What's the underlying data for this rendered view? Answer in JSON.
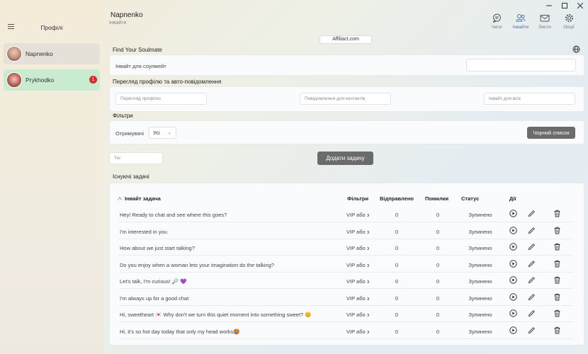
{
  "sidebar": {
    "title": "Профілі",
    "profiles": [
      {
        "name": "Napnenko",
        "badge": ""
      },
      {
        "name": "Prykhodko",
        "badge": "1"
      }
    ]
  },
  "header": {
    "title": "Napnenko",
    "subtitle": "Інвайти",
    "tabs": [
      {
        "label": "Чати",
        "icon": "chat-icon"
      },
      {
        "label": "Інвайти",
        "icon": "users-icon"
      },
      {
        "label": "Листи",
        "icon": "mail-icon"
      },
      {
        "label": "Опції",
        "icon": "gear-icon"
      }
    ],
    "active_tab": "Інвайти"
  },
  "affiliate_label": "Affiliact.com",
  "soulmate": {
    "section_title": "Find Your Soulmate",
    "invite_label": "Інвайт для соулмейт",
    "invite_value": ""
  },
  "profile_view": {
    "section_title": "Перегляд профілю та авто-повідомлення",
    "view_placeholder": "Перегляд профілю",
    "contacts_placeholder": "Повідомлення для контактів",
    "all_placeholder": "Інвайт для всіх"
  },
  "filters": {
    "section_title": "Фільтри",
    "recipients_label": "Отримувачі",
    "recipients_value": "Усі",
    "blacklist_button": "Чорний список"
  },
  "tag_placeholder": "Тег",
  "add_task_button": "Додати задачу",
  "tasks": {
    "section_title": "Існуючі задачі",
    "columns": {
      "invite": "Інвайт задача",
      "filters": "Фільтри",
      "sent": "Відправлено",
      "errors": "Помилки",
      "status": "Статус",
      "actions": "Дії"
    },
    "rows": [
      {
        "invite": "Hey! Ready to chat and see where this goes?",
        "filters": "VIP або з",
        "sent": "0",
        "errors": "0",
        "status": "Зупинено"
      },
      {
        "invite": "I'm interested in you",
        "filters": "VIP або з",
        "sent": "0",
        "errors": "0",
        "status": "Зупинено"
      },
      {
        "invite": "How about we just start talking?",
        "filters": "VIP або з",
        "sent": "0",
        "errors": "0",
        "status": "Зупинено"
      },
      {
        "invite": "Do you enjoy when a woman lets your imagination do the talking?",
        "filters": "VIP або з",
        "sent": "0",
        "errors": "0",
        "status": "Зупинено"
      },
      {
        "invite": "Let's talk, I'm curious! 🔎 💜",
        "filters": "VIP або з",
        "sent": "0",
        "errors": "0",
        "status": "Зупинено"
      },
      {
        "invite": "I'm always up for a good chat",
        "filters": "VIP або з",
        "sent": "0",
        "errors": "0",
        "status": "Зупинено"
      },
      {
        "invite": "Hi, sweetheart 💌 Why don't we turn this quiet moment into something sweet? 😊",
        "filters": "VIP або з",
        "sent": "0",
        "errors": "0",
        "status": "Зупинено"
      },
      {
        "invite": "Hi, it's so hot day today that only my head works🥵",
        "filters": "VIP або з",
        "sent": "0",
        "errors": "0",
        "status": "Зупинено"
      }
    ]
  }
}
